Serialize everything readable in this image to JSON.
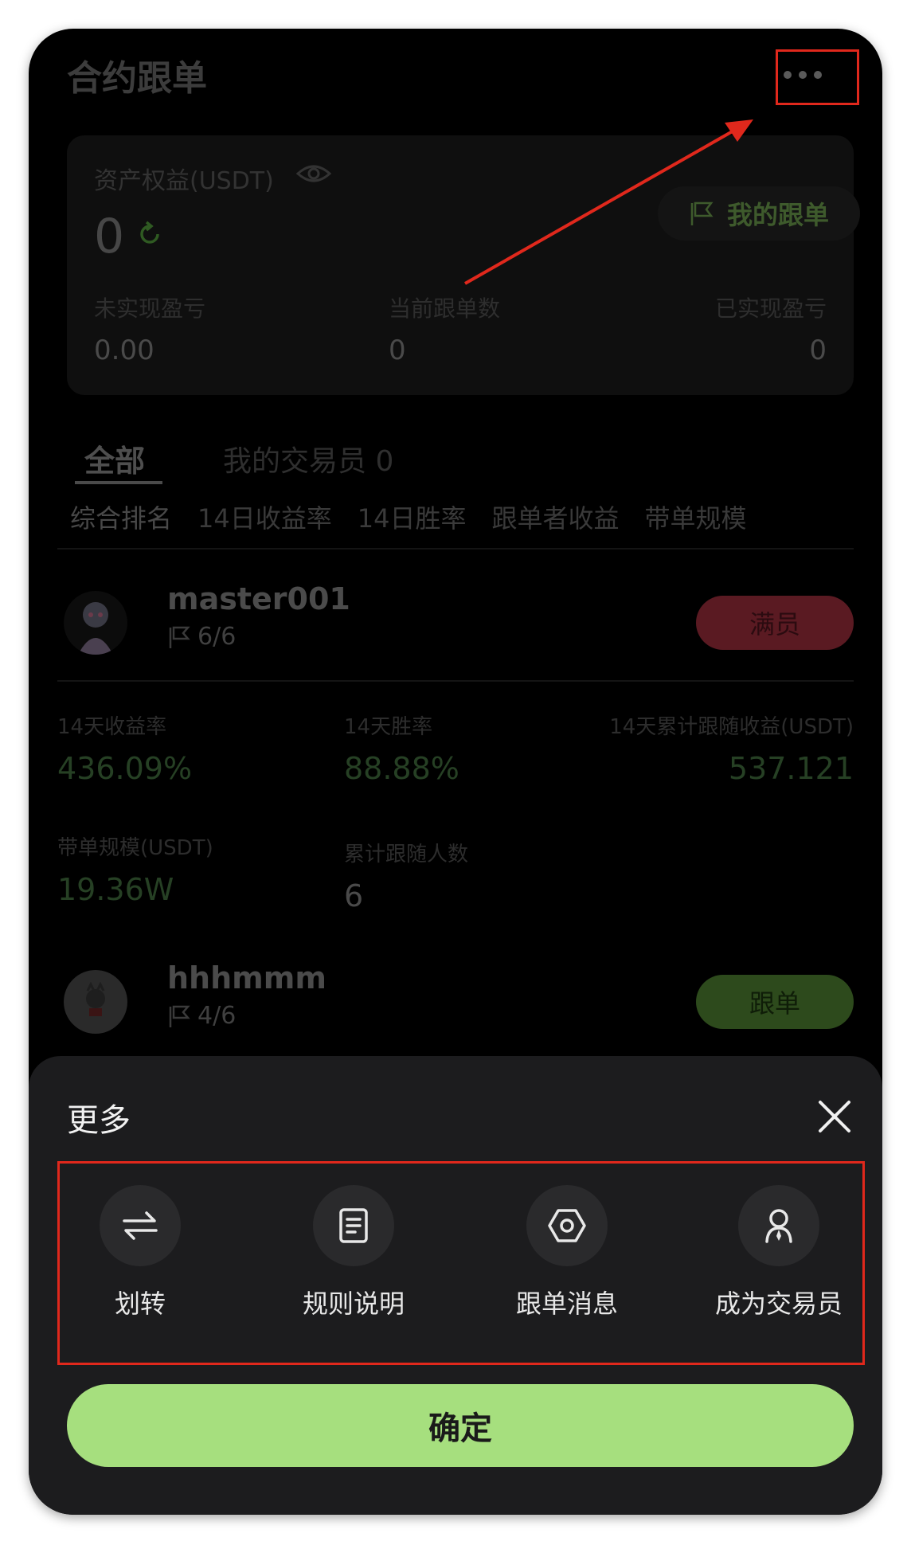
{
  "header": {
    "title": "合约跟单"
  },
  "asset": {
    "label": "资产权益(USDT)",
    "value": "0",
    "my_copy_label": "我的跟单",
    "stats": [
      {
        "label": "未实现盈亏",
        "value": "0.00"
      },
      {
        "label": "当前跟单数",
        "value": "0"
      },
      {
        "label": "已实现盈亏",
        "value": "0"
      }
    ]
  },
  "tabs": {
    "all": "全部",
    "my_traders": "我的交易员 0"
  },
  "filters": [
    "综合排名",
    "14日收益率",
    "14日胜率",
    "跟单者收益",
    "带单规模"
  ],
  "traders": [
    {
      "name": "master001",
      "count": "6/6",
      "button": "满员",
      "metrics": {
        "roi_label": "14天收益率",
        "roi": "436.09%",
        "win_label": "14天胜率",
        "win": "88.88%",
        "profit_label": "14天累计跟随收益(USDT)",
        "profit": "537.121",
        "scale_label": "带单规模(USDT)",
        "scale": "19.36W",
        "followers_label": "累计跟随人数",
        "followers": "6"
      }
    },
    {
      "name": "hhhmmm",
      "count": "4/6",
      "button": "跟单"
    }
  ],
  "sheet": {
    "title": "更多",
    "options": [
      {
        "label": "划转",
        "icon": "transfer-icon"
      },
      {
        "label": "规则说明",
        "icon": "document-icon"
      },
      {
        "label": "跟单消息",
        "icon": "hexagon-message-icon"
      },
      {
        "label": "成为交易员",
        "icon": "user-icon"
      }
    ],
    "confirm": "确定"
  },
  "colors": {
    "accent_green": "#a6df7e",
    "annotation_red": "#e0281c",
    "sheet_bg": "#1c1c1e"
  }
}
